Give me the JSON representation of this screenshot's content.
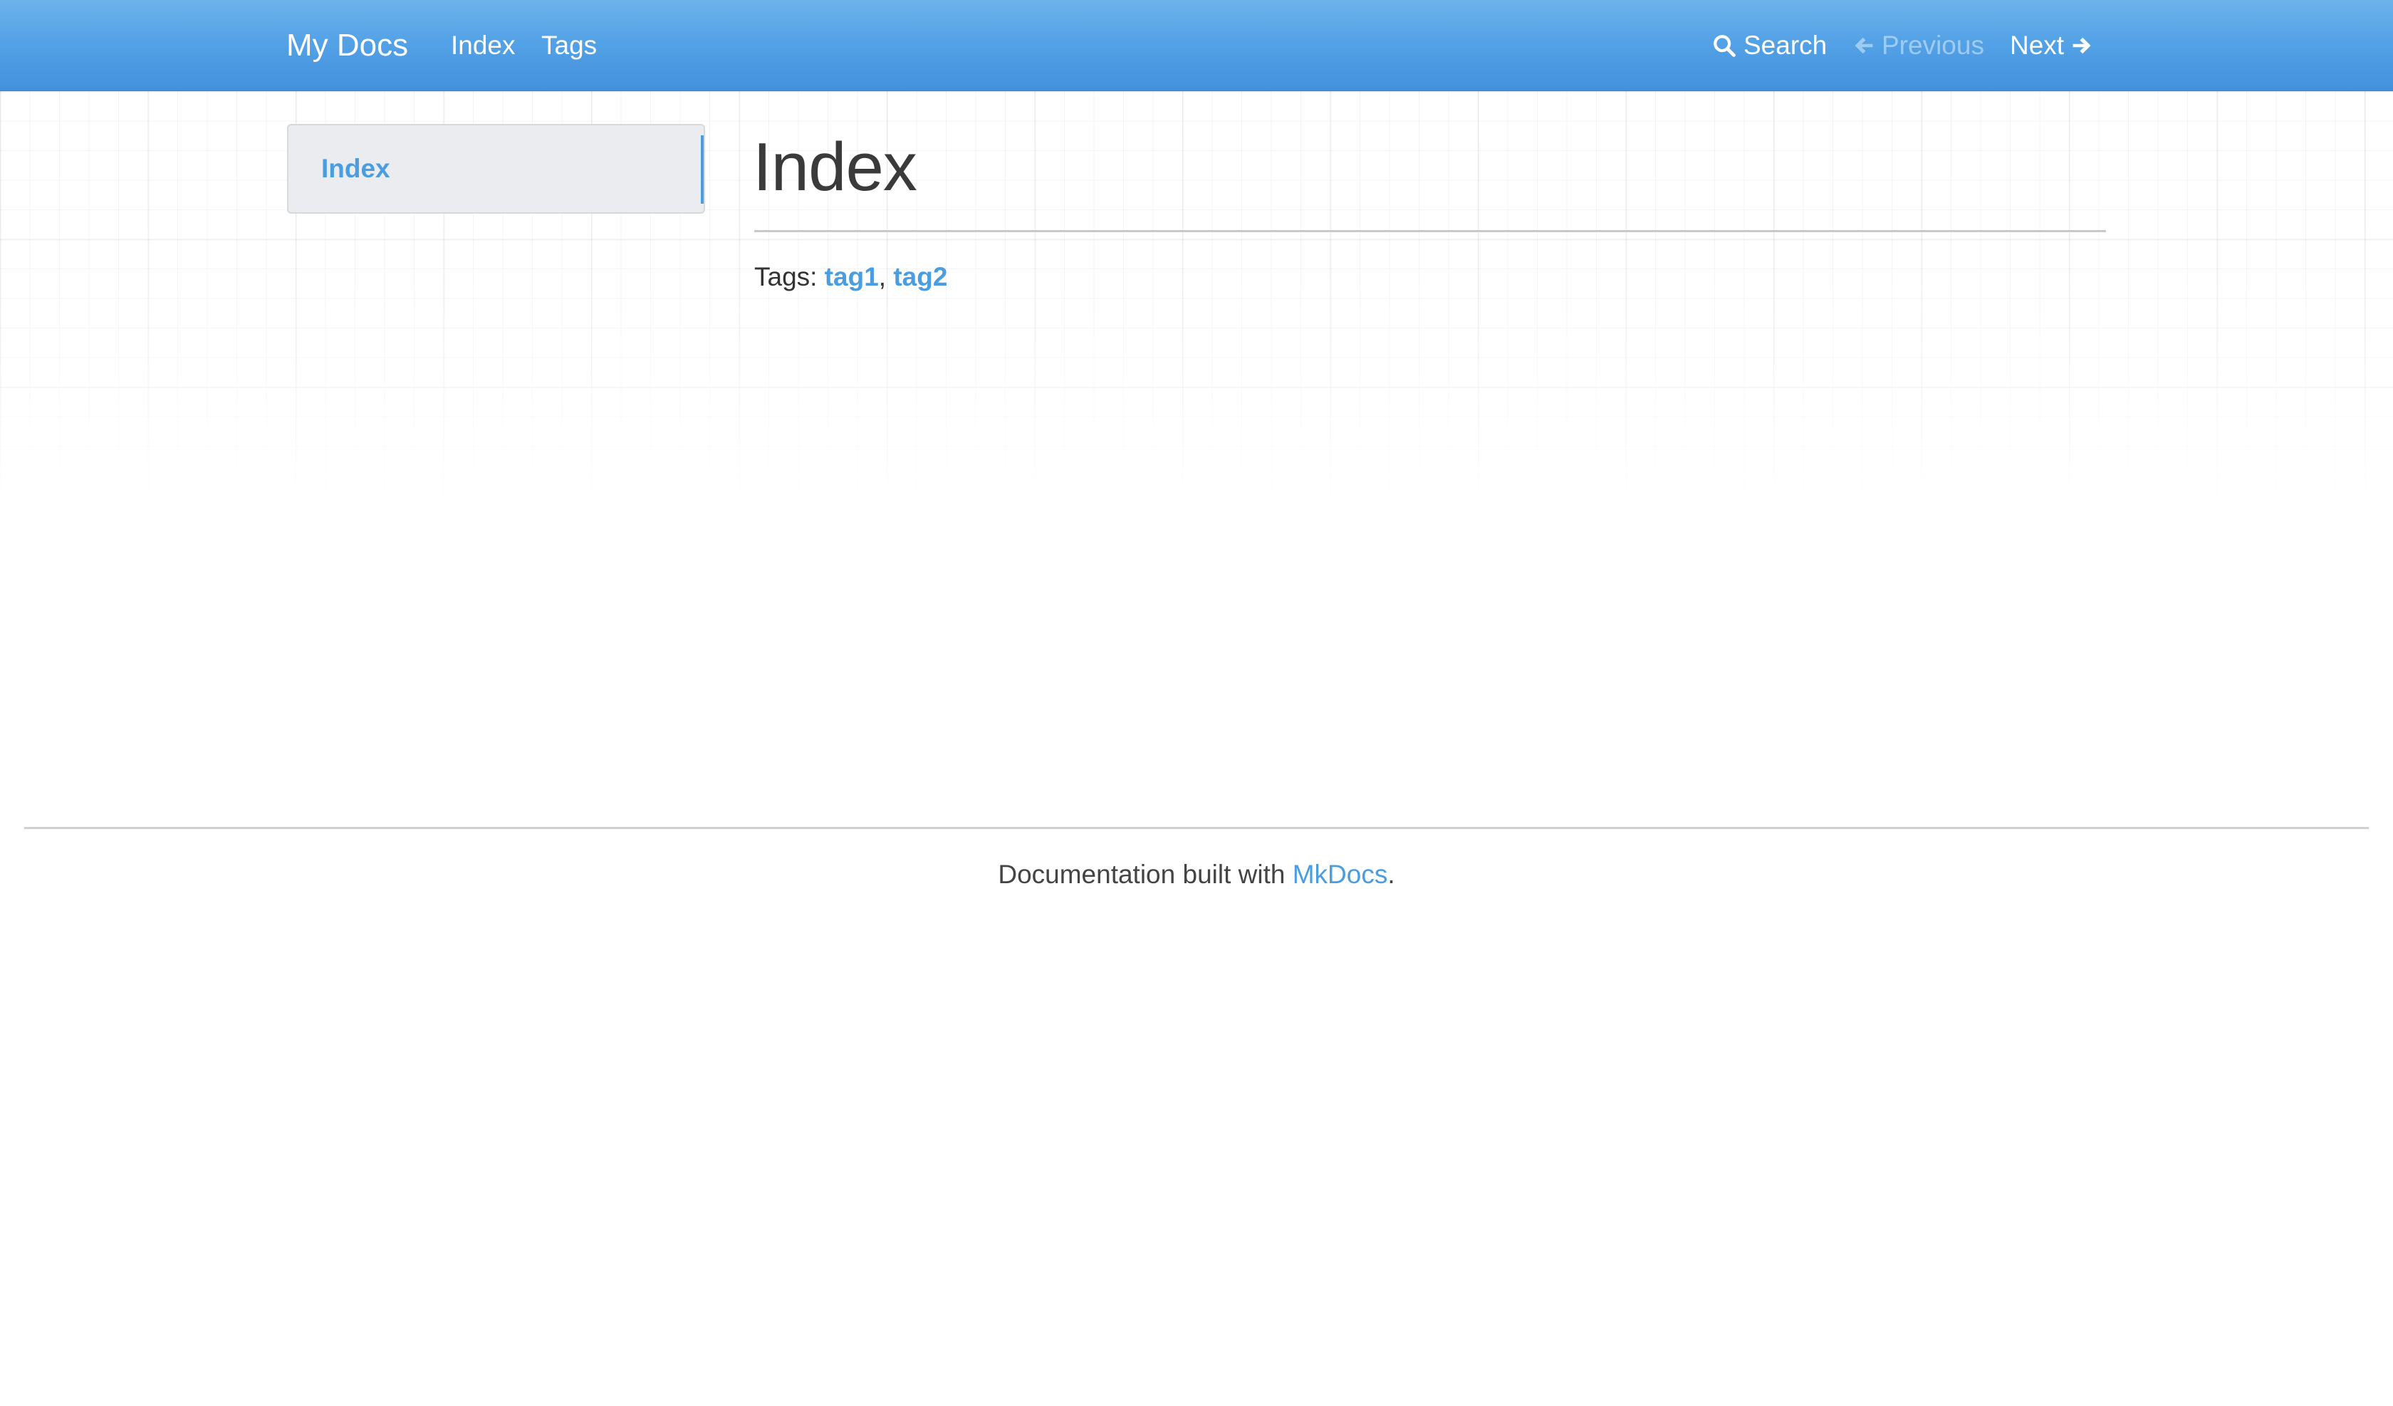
{
  "navbar": {
    "brand": "My Docs",
    "links": [
      "Index",
      "Tags"
    ],
    "search_label": "Search",
    "previous_label": "Previous",
    "next_label": "Next",
    "icons": {
      "search": "search-icon",
      "previous": "arrow-left-icon",
      "next": "arrow-right-icon"
    },
    "colors": {
      "gradient_top": "#6db3ec",
      "gradient_bottom": "#4390dd",
      "disabled_text": "rgba(255,255,255,0.45)"
    }
  },
  "sidebar": {
    "items": [
      {
        "label": "Index",
        "active": true
      }
    ]
  },
  "main": {
    "title": "Index",
    "tags_prefix": "Tags:",
    "tags": [
      "tag1",
      "tag2"
    ],
    "tag_separator": ","
  },
  "footer": {
    "text_before": "Documentation built with",
    "link_text": "MkDocs",
    "text_after": "."
  },
  "colors": {
    "accent": "#4a9de0",
    "text": "#333333",
    "sidebar_bg": "#ebecef"
  }
}
